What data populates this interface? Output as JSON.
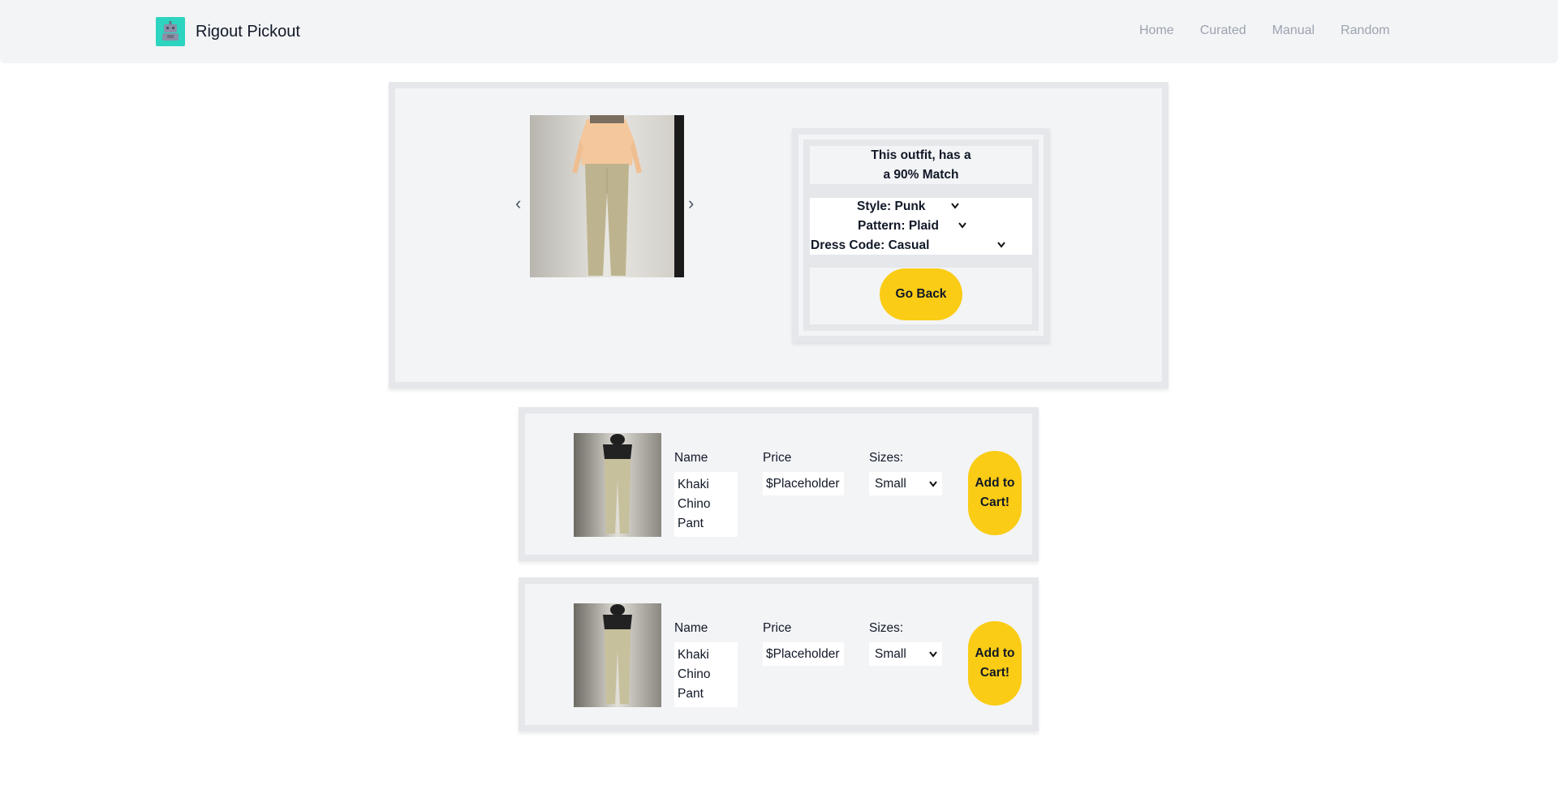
{
  "header": {
    "brand": "Rigout Pickout",
    "nav": [
      "Home",
      "Curated",
      "Manual",
      "Random"
    ]
  },
  "hero": {
    "match_line1": "This outfit, has a",
    "match_line2": "a 90% Match",
    "filters": {
      "style": "Style: Punk",
      "pattern": "Pattern: Plaid",
      "dress_code": "Dress Code: Casual"
    },
    "go_back": "Go Back",
    "arrow_left": "‹",
    "arrow_right": "›"
  },
  "products": [
    {
      "name_label": "Name",
      "name": "Khaki Chino Pant",
      "price_label": "Price",
      "price": "$Placeholder",
      "sizes_label": "Sizes:",
      "size": "Small",
      "cart": "Add to Cart!"
    },
    {
      "name_label": "Name",
      "name": "Khaki Chino Pant",
      "price_label": "Price",
      "price": "$Placeholder",
      "sizes_label": "Sizes:",
      "size": "Small",
      "cart": "Add to Cart!"
    }
  ],
  "icons": {
    "logo": "robot-icon",
    "chevron": "chevron-down-icon"
  },
  "colors": {
    "accent": "#facc15",
    "logo_bg": "#2dd4bf",
    "panel_bg": "#f3f4f6",
    "panel_border": "#e5e7eb",
    "nav_text": "#9ca3af"
  }
}
